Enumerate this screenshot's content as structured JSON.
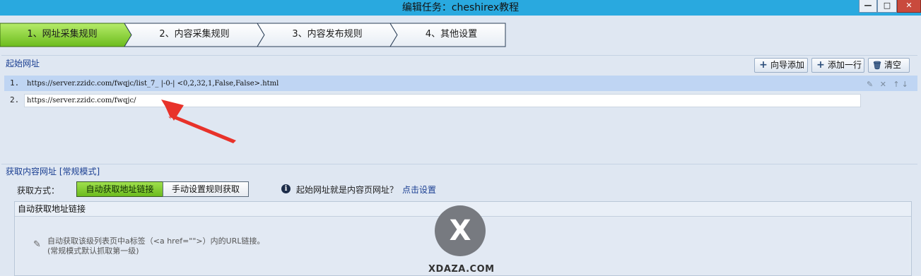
{
  "window": {
    "title": "编辑任务：cheshirex教程",
    "controls": [
      "—",
      "□",
      "✕"
    ]
  },
  "steps": [
    {
      "label": "1、网址采集规则",
      "active": true
    },
    {
      "label": "2、内容采集规则",
      "active": false
    },
    {
      "label": "3、内容发布规则",
      "active": false
    },
    {
      "label": "4、其他设置",
      "active": false
    }
  ],
  "start_urls": {
    "section_label": "起始网址",
    "buttons": {
      "wizard": "向导添加",
      "add_row": "添加一行",
      "clear": "清空"
    },
    "rows": [
      {
        "num": "1.",
        "value": "https://server.zzidc.com/fwqjc/list_7_ |-0-| <0,2,32,1,False,False>.html",
        "selected": true
      },
      {
        "num": "2.",
        "value": "https://server.zzidc.com/fwqjc/",
        "selected": false
      }
    ],
    "row_icons": "✎ ✕ ↑↓"
  },
  "fetch": {
    "section_label": "获取内容网址 [常规模式]",
    "method_label": "获取方式：",
    "modes": [
      "自动获取地址链接",
      "手动设置规则获取"
    ],
    "active_mode": 0,
    "info_icon": "i",
    "question": "起始网址就是内容页网址？",
    "link": "点击设置",
    "subpanel_title": "自动获取地址链接",
    "hint_line1": "自动获取该级列表页中a标签（<a href=\"\">）内的URL链接。",
    "hint_line2": "(常规模式默认抓取第一级)"
  },
  "watermark": {
    "letter": "X",
    "text": "XDAZA.COM"
  },
  "colors": {
    "titlebar": "#29a9df",
    "step_active": "#8ed33c",
    "accent_link": "#1b3f92",
    "arrow": "#e8322a"
  }
}
